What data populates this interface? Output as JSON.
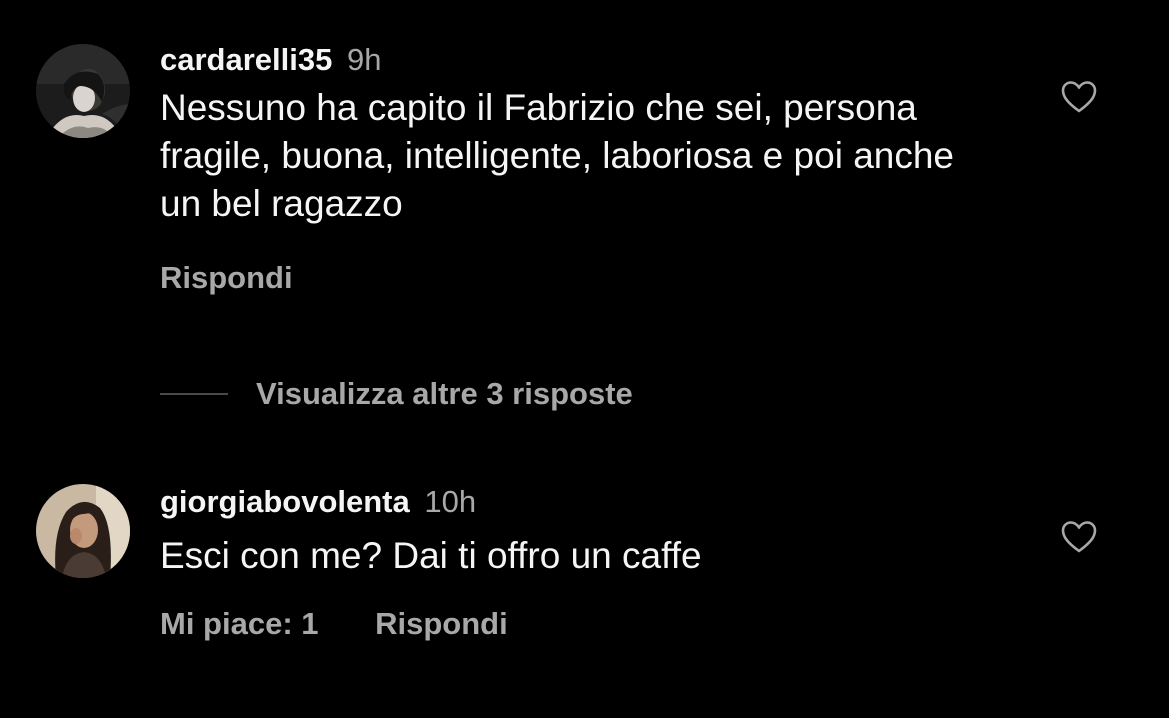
{
  "comments": [
    {
      "username": "cardarelli35",
      "time": "9h",
      "text": "Nessuno ha capito il Fabrizio che sei, persona fragile, buona, intelligente, laboriosa e poi anche un bel ragazzo",
      "reply_label": "Rispondi"
    },
    {
      "username": "giorgiabovolenta",
      "time": "10h",
      "text": "Esci con me? Dai ti offro un caffe",
      "likes_label": "Mi piace: 1",
      "reply_label": "Rispondi"
    }
  ],
  "view_replies_label": "Visualizza altre 3 risposte",
  "icons": {
    "like": "heart-outline-icon"
  },
  "colors": {
    "background": "#000000",
    "primary_text": "#f5f5f5",
    "secondary_text": "#a8a8a8"
  }
}
